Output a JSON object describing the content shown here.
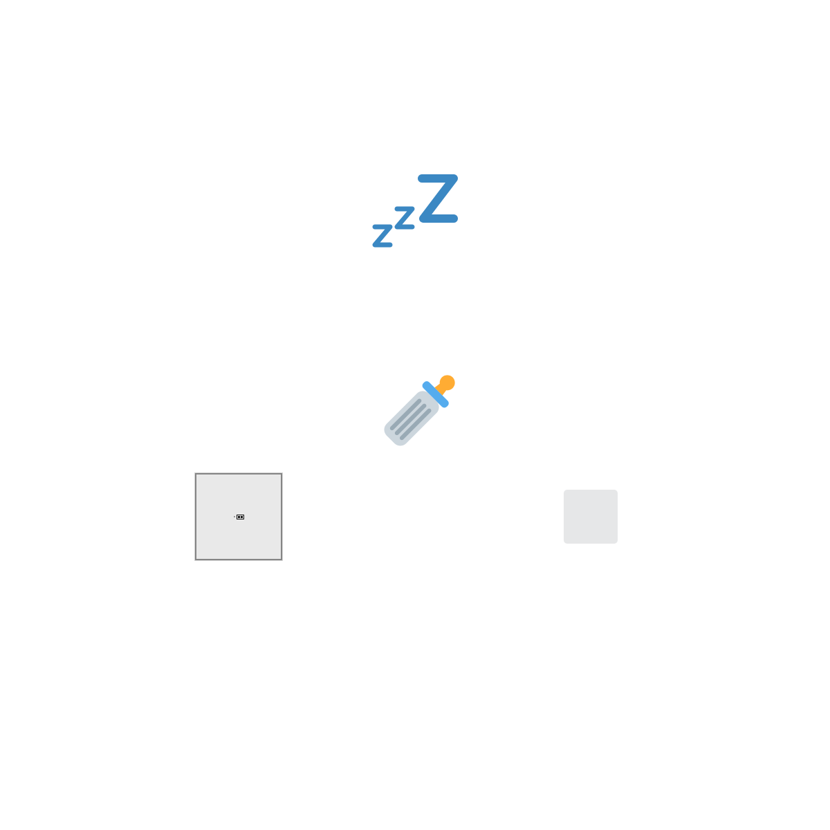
{
  "icons": [
    {
      "name": "zzz-icon",
      "color": "#3b88c3"
    },
    {
      "name": "baby-bottle-icon",
      "colors": {
        "body": "#ccd6dd",
        "stripes": "#99aab5",
        "ring": "#55acee",
        "nipple": "#ffac33"
      }
    },
    {
      "name": "missing-glyph-icon",
      "background": "#e9e9e9",
      "border": "#858585"
    },
    {
      "name": "blank-tile",
      "background": "#e6e7e8"
    }
  ]
}
